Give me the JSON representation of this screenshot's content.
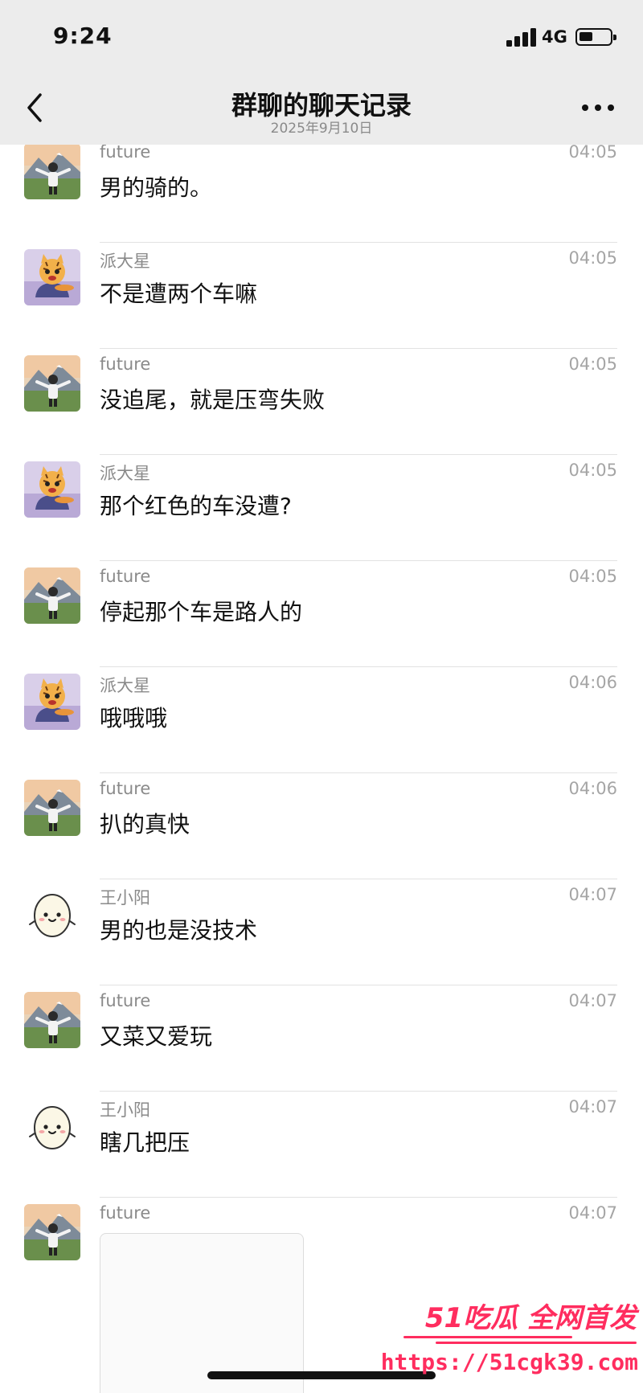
{
  "status_bar": {
    "time": "9:24",
    "network": "4G",
    "battery_level": 0.45
  },
  "nav": {
    "title": "群聊的聊天记录",
    "subtitle": "2025年9月10日",
    "back_icon": "chevron-left-icon",
    "more_icon": "more-dots-icon"
  },
  "messages": [
    {
      "sender": "future",
      "time": "04:05",
      "text": "男的骑的。",
      "avatar": "landscape-person-avatar"
    },
    {
      "sender": "派大星",
      "time": "04:05",
      "text": "不是遭两个车嘛",
      "avatar": "cat-avatar"
    },
    {
      "sender": "future",
      "time": "04:05",
      "text": "没追尾，就是压弯失败",
      "avatar": "landscape-person-avatar"
    },
    {
      "sender": "派大星",
      "time": "04:05",
      "text": "那个红色的车没遭?",
      "avatar": "cat-avatar"
    },
    {
      "sender": "future",
      "time": "04:05",
      "text": "停起那个车是路人的",
      "avatar": "landscape-person-avatar"
    },
    {
      "sender": "派大星",
      "time": "04:06",
      "text": "哦哦哦",
      "avatar": "cat-avatar"
    },
    {
      "sender": "future",
      "time": "04:06",
      "text": "扒的真快",
      "avatar": "landscape-person-avatar"
    },
    {
      "sender": "王小阳",
      "time": "04:07",
      "text": "男的也是没技术",
      "avatar": "egg-face-avatar"
    },
    {
      "sender": "future",
      "time": "04:07",
      "text": "又菜又爱玩",
      "avatar": "landscape-person-avatar"
    },
    {
      "sender": "王小阳",
      "time": "04:07",
      "text": "瞎几把压",
      "avatar": "egg-face-avatar"
    },
    {
      "sender": "future",
      "time": "04:07",
      "text": "",
      "avatar": "landscape-person-avatar",
      "attachment": "image"
    }
  ],
  "watermark": {
    "line1": "51吃瓜 全网首发",
    "line2": "https://51cgk39.com"
  },
  "colors": {
    "header_bg": "#ececec",
    "watermark": "#ff2d5f",
    "meta_text": "#8a8a8a"
  }
}
